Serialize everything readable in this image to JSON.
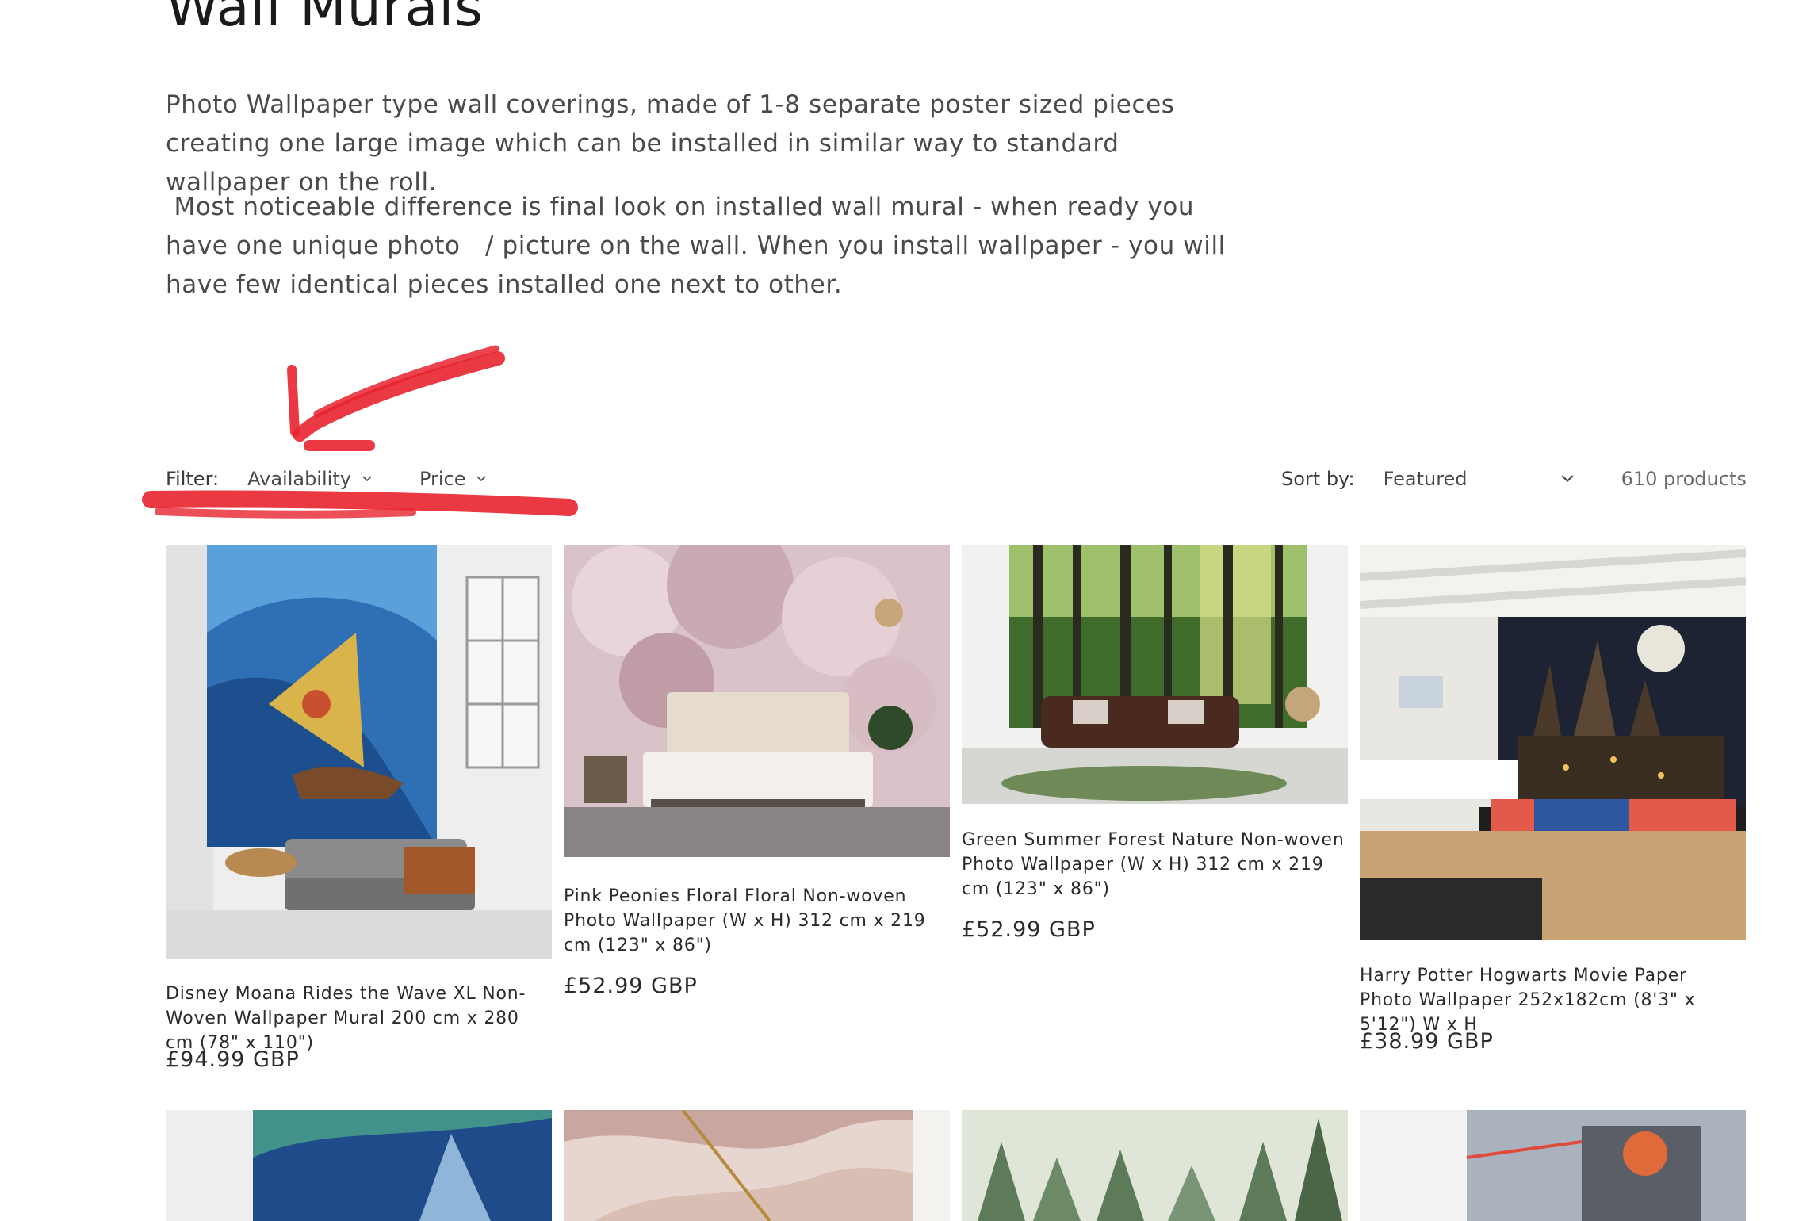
{
  "heading": "Wall Murals",
  "description": [
    "Photo Wallpaper type wall coverings, made of 1-8 separate poster sized pieces creating one large image which can be installed in similar way to standard wallpaper on the roll.",
    " Most noticeable difference is final look on installed wall mural - when ready you have one unique photo   / picture on the wall. When you install wallpaper - you will have few identical pieces installed one next to other."
  ],
  "filter": {
    "label": "Filter:",
    "availability": "Availability",
    "price": "Price"
  },
  "sort": {
    "label": "Sort by:",
    "selected": "Featured",
    "count": "610 products"
  },
  "products": [
    {
      "name": "Disney Moana Rides the Wave XL Non-Woven Wallpaper Mural 200 cm x 280 cm (78\" x 110\")",
      "price": "£94.99 GBP"
    },
    {
      "name": "Pink Peonies Floral Floral Non-woven Photo Wallpaper (W x H) 312 cm x 219 cm (123\" x 86\")",
      "price": "£52.99 GBP"
    },
    {
      "name": "Green Summer Forest Nature Non-woven Photo Wallpaper (W x H) 312 cm x 219 cm (123\" x 86\")",
      "price": "£52.99 GBP"
    },
    {
      "name": "Harry Potter Hogwarts Movie Paper Photo Wallpaper 252x182cm (8'3\" x 5'12\") W x H",
      "price": "£38.99 GBP"
    }
  ],
  "colors": {
    "annotation": "#e8232f",
    "text": "#2b2b2b",
    "muted": "#4a4a4a"
  }
}
